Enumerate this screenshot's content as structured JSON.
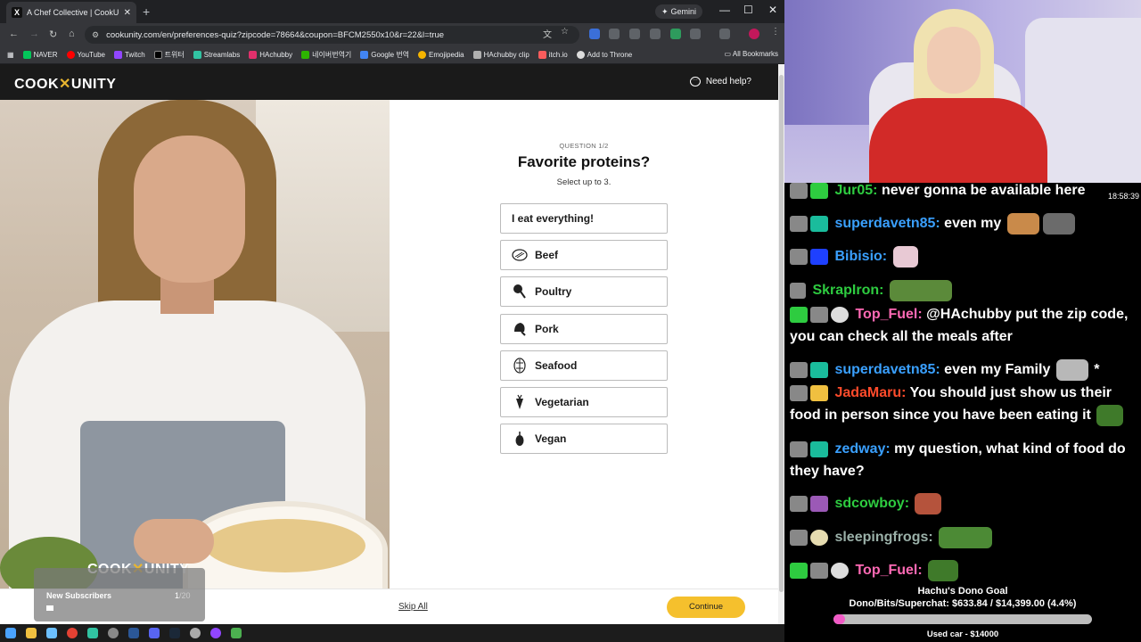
{
  "browser": {
    "tab_title": "A Chef Collective | CookUnity |",
    "tab_favicon": "X",
    "gemini_label": "Gemini",
    "url": "cookunity.com/en/preferences-quiz?zipcode=78664&coupon=BFCM2550x10&r=22&l=true",
    "bookmarks": [
      "NAVER",
      "YouTube",
      "Twitch",
      "트위터",
      "Streamlabs",
      "HAchubby",
      "네이버번역기",
      "Google 번역",
      "Emojipedia",
      "HAchubby clip",
      "itch.io",
      "Add to Throne"
    ],
    "all_bookmarks": "All Bookmarks"
  },
  "site": {
    "logo_left": "COOK",
    "logo_x": "✕",
    "logo_right": "UNITY",
    "help": "Need help?"
  },
  "quiz": {
    "step": "QUESTION 1/2",
    "title": "Favorite proteins?",
    "subtitle": "Select up to 3.",
    "options": [
      {
        "label": "I eat everything!",
        "icon": ""
      },
      {
        "label": "Beef",
        "icon": "beef-icon"
      },
      {
        "label": "Poultry",
        "icon": "poultry-icon"
      },
      {
        "label": "Pork",
        "icon": "pork-icon"
      },
      {
        "label": "Seafood",
        "icon": "seafood-icon"
      },
      {
        "label": "Vegetarian",
        "icon": "carrot-icon"
      },
      {
        "label": "Vegan",
        "icon": "eggplant-icon"
      }
    ],
    "skip": "Skip All",
    "continue": "Continue"
  },
  "subs_widget": {
    "label": "New Subscribers",
    "count": "1",
    "total": "/20"
  },
  "stream": {
    "timestamp": "18:58:39",
    "chat": [
      {
        "user": "Jur05:",
        "color": "#2ecc40",
        "text": "never gonna be available here"
      },
      {
        "user": "superdavetn85:",
        "color": "#3aa0ff",
        "text": "even my"
      },
      {
        "user": "Bibisio:",
        "color": "#3aa0ff",
        "text": ""
      },
      {
        "user": "SkrapIron:",
        "color": "#2ecc40",
        "text": ""
      },
      {
        "user": "Top_Fuel:",
        "color": "#ff69b4",
        "text": "@HAchubby put the zip code, you can check all the meals after"
      },
      {
        "user": "superdavetn85:",
        "color": "#3aa0ff",
        "text": "even my Family"
      },
      {
        "user": "JadaMaru:",
        "color": "#ff4b2b",
        "text": "You should just show us their food in person since you have been eating it"
      },
      {
        "user": "zedway:",
        "color": "#3aa0ff",
        "text": "my question, what kind of food do they have?"
      },
      {
        "user": "sdcowboy:",
        "color": "#2ecc40",
        "text": ""
      },
      {
        "user": "sleepingfrogs:",
        "color": "#9ab0a8",
        "text": ""
      },
      {
        "user": "Top_Fuel:",
        "color": "#ff69b4",
        "text": ""
      }
    ],
    "goal": {
      "title": "Hachu's Dono Goal",
      "amount": "Dono/Bits/Superchat: $633.84 / $14,399.00 (4.4%)",
      "fraction": 0.044,
      "target": "Used car - $14000"
    }
  },
  "colors": {
    "accent_button": "#f5c02d",
    "goal_fill": "#f15ac6",
    "logo_x": "#e8b530"
  }
}
